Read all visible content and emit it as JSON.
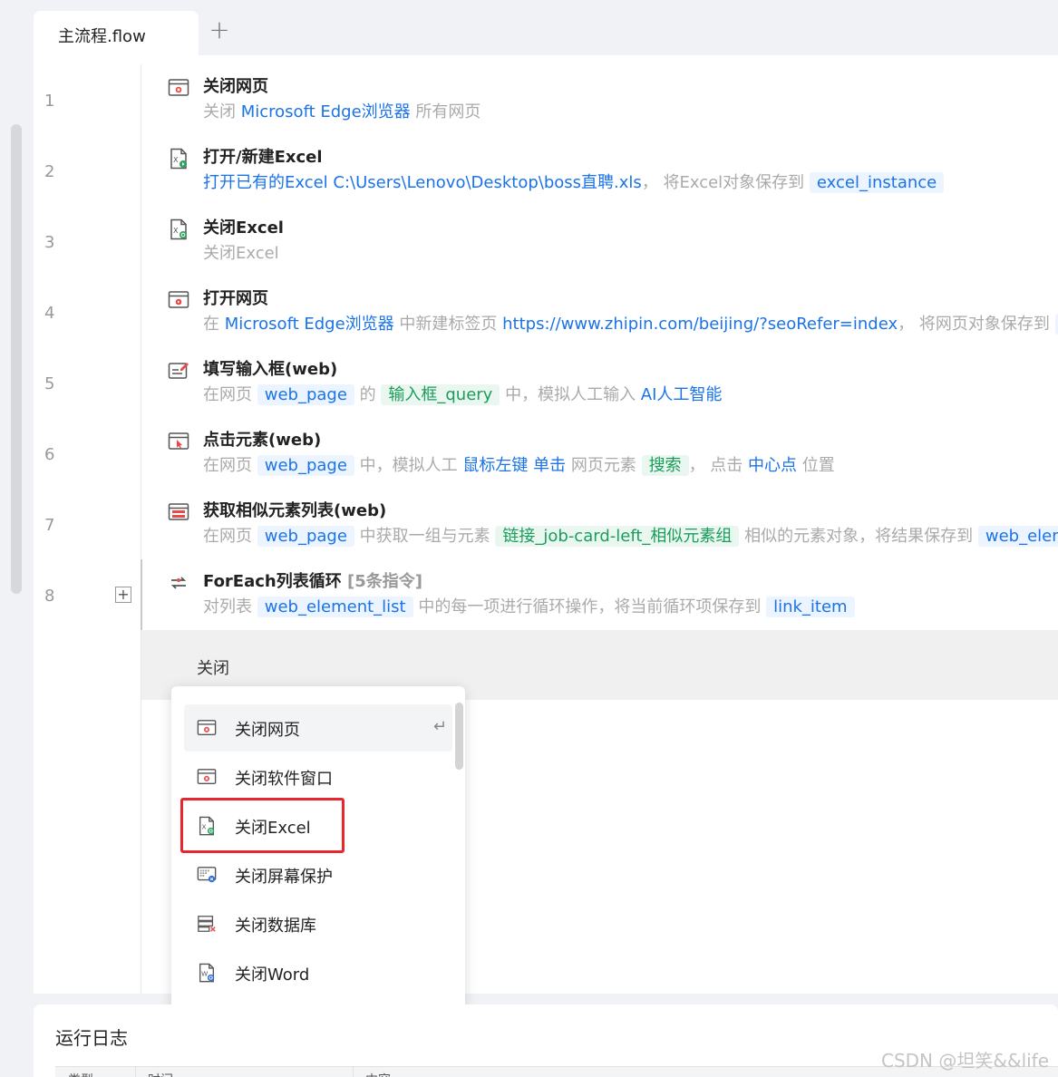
{
  "tabs": {
    "active_label": "主流程.flow",
    "add_label": "+"
  },
  "rows": [
    {
      "num": "1",
      "icon": "close-webpage-icon",
      "title": "关闭网页",
      "desc": [
        {
          "t": "关闭 ",
          "c": "gray"
        },
        {
          "t": "Microsoft Edge浏览器",
          "c": "blue"
        },
        {
          "t": " 所有网页",
          "c": "gray"
        }
      ]
    },
    {
      "num": "2",
      "icon": "open-excel-icon",
      "title": "打开/新建Excel",
      "desc": [
        {
          "t": "打开已有的Excel",
          "c": "blue"
        },
        {
          "t": "   ",
          "c": "gray"
        },
        {
          "t": "C:\\Users\\Lenovo\\Desktop\\boss直聘.xls",
          "c": "blue"
        },
        {
          "t": "， 将Excel对象保存到 ",
          "c": "gray"
        },
        {
          "t": "excel_instance",
          "c": "tag-blue"
        }
      ]
    },
    {
      "num": "3",
      "icon": "close-excel-icon",
      "title": "关闭Excel",
      "desc": [
        {
          "t": "关闭Excel",
          "c": "gray"
        }
      ]
    },
    {
      "num": "4",
      "icon": "open-webpage-icon",
      "title": "打开网页",
      "desc": [
        {
          "t": "在 ",
          "c": "gray"
        },
        {
          "t": "Microsoft Edge浏览器",
          "c": "blue"
        },
        {
          "t": " 中新建标签页 ",
          "c": "gray"
        },
        {
          "t": "https://www.zhipin.com/beijing/?seoRefer=index",
          "c": "blue"
        },
        {
          "t": "， 将网页对象保存到 ",
          "c": "gray"
        },
        {
          "t": "w",
          "c": "tag-blue"
        }
      ]
    },
    {
      "num": "5",
      "icon": "fill-input-icon",
      "title": "填写输入框(web)",
      "desc": [
        {
          "t": "在网页 ",
          "c": "gray"
        },
        {
          "t": "web_page",
          "c": "tag-blue"
        },
        {
          "t": " 的 ",
          "c": "gray"
        },
        {
          "t": "输入框_query",
          "c": "tag-green"
        },
        {
          "t": " 中，模拟人工输入 ",
          "c": "gray"
        },
        {
          "t": "AI人工智能",
          "c": "blue"
        }
      ]
    },
    {
      "num": "6",
      "icon": "click-element-icon",
      "title": "点击元素(web)",
      "desc": [
        {
          "t": "在网页 ",
          "c": "gray"
        },
        {
          "t": "web_page",
          "c": "tag-blue"
        },
        {
          "t": " 中，模拟人工 ",
          "c": "gray"
        },
        {
          "t": "鼠标左键 单击",
          "c": "blue"
        },
        {
          "t": " 网页元素 ",
          "c": "gray"
        },
        {
          "t": "搜索",
          "c": "tag-green"
        },
        {
          "t": "， 点击 ",
          "c": "gray"
        },
        {
          "t": "中心点",
          "c": "blue"
        },
        {
          "t": " 位置",
          "c": "gray"
        }
      ]
    },
    {
      "num": "7",
      "icon": "similar-elements-icon",
      "title": "获取相似元素列表(web)",
      "desc": [
        {
          "t": "在网页 ",
          "c": "gray"
        },
        {
          "t": "web_page",
          "c": "tag-blue"
        },
        {
          "t": " 中获取一组与元素 ",
          "c": "gray"
        },
        {
          "t": "链接_job-card-left_相似元素组",
          "c": "tag-green"
        },
        {
          "t": " 相似的元素对象，将结果保存到 ",
          "c": "gray"
        },
        {
          "t": "web_eleme",
          "c": "tag-blue"
        }
      ]
    },
    {
      "num": "8",
      "icon": "foreach-loop-icon",
      "title": "ForEach列表循环",
      "title_suffix": " [5条指令]",
      "expand": "+",
      "desc": [
        {
          "t": "对列表 ",
          "c": "gray"
        },
        {
          "t": "web_element_list",
          "c": "tag-blue"
        },
        {
          "t": " 中的每一项进行循环操作，将当前循环项保存到 ",
          "c": "gray"
        },
        {
          "t": "link_item",
          "c": "tag-blue"
        }
      ]
    }
  ],
  "insert": {
    "query": "关闭"
  },
  "dropdown": {
    "items": [
      {
        "label": "关闭网页",
        "icon": "close-webpage-icon",
        "highlighted": true,
        "enter": "↵"
      },
      {
        "label": "关闭软件窗口",
        "icon": "close-window-icon"
      },
      {
        "label": "关闭Excel",
        "icon": "close-excel-icon",
        "selected_box": true
      },
      {
        "label": "关闭屏幕保护",
        "icon": "close-screensaver-icon"
      },
      {
        "label": "关闭数据库",
        "icon": "close-database-icon"
      },
      {
        "label": "关闭Word",
        "icon": "close-word-icon"
      }
    ]
  },
  "log": {
    "title": "运行日志",
    "columns": [
      "类型",
      "时间",
      "内容"
    ]
  },
  "watermark": "CSDN @坦笑&&life",
  "colors": {
    "link_blue": "#1a73e8",
    "tag_green": "#1a9c5b",
    "highlight_red": "#e8262e"
  }
}
